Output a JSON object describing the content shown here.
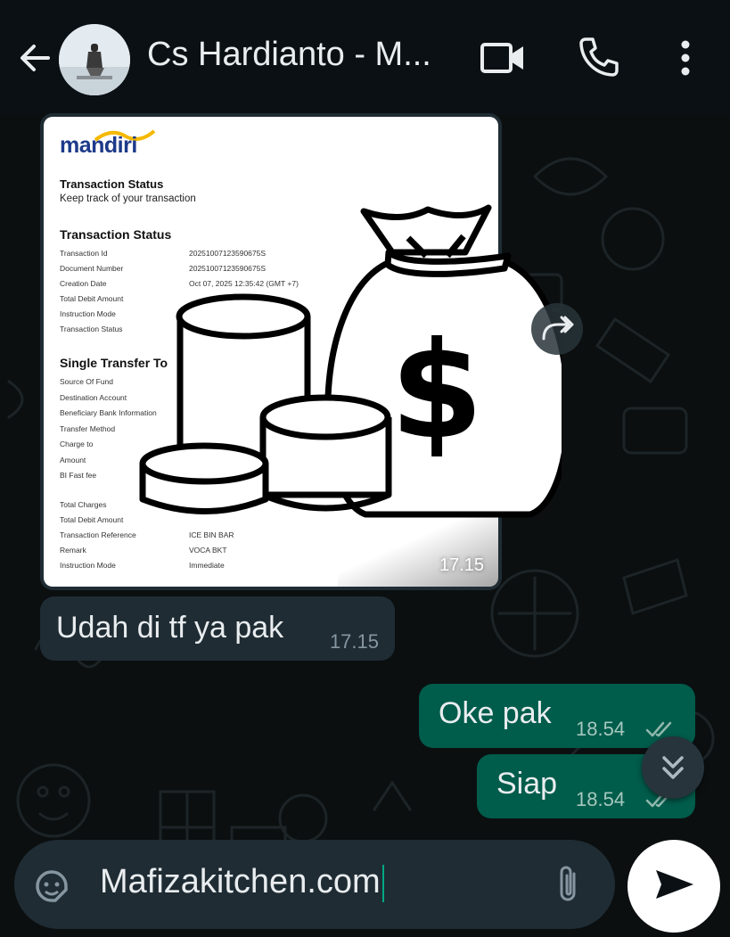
{
  "header": {
    "contact_name": "Cs Hardianto - M..."
  },
  "image_message": {
    "time": "17.15",
    "receipt": {
      "brand": "mandiri",
      "title": "Transaction Status",
      "subtitle": "Keep track of your transaction",
      "section1": "Transaction Status",
      "rows1": [
        {
          "k": "Transaction Id",
          "v": "20251007123590675S"
        },
        {
          "k": "Document Number",
          "v": "20251007123590675S"
        },
        {
          "k": "Creation Date",
          "v": "Oct 07, 2025 12:35:42 (GMT +7)"
        },
        {
          "k": "Total Debit Amount",
          "v": ""
        },
        {
          "k": "Instruction Mode",
          "v": ""
        },
        {
          "k": "Transaction Status",
          "v": ""
        }
      ],
      "section2": "Single Transfer To",
      "rows2": [
        {
          "k": "Source Of Fund",
          "v": ""
        },
        {
          "k": "Destination Account",
          "v": ""
        },
        {
          "k": "Beneficiary Bank Information",
          "v": ""
        },
        {
          "k": "Transfer Method",
          "v": ""
        },
        {
          "k": "Charge to",
          "v": ""
        },
        {
          "k": "Amount",
          "v": ""
        },
        {
          "k": "BI Fast fee",
          "v": ""
        }
      ],
      "rows3": [
        {
          "k": "Total Charges",
          "v": ""
        },
        {
          "k": "Total Debit Amount",
          "v": ""
        },
        {
          "k": "Transaction Reference",
          "v": "ICE BIN BAR"
        },
        {
          "k": "Remark",
          "v": "VOCA BKT"
        },
        {
          "k": "Instruction Mode",
          "v": "Immediate"
        }
      ]
    }
  },
  "messages": [
    {
      "direction": "in",
      "text": "Udah di tf ya pak",
      "time": "17.15"
    },
    {
      "direction": "out",
      "text": "Oke pak",
      "time": "18.54"
    },
    {
      "direction": "out",
      "text": "Siap",
      "time": "18.54"
    }
  ],
  "composer": {
    "value": "Mafizakitchen.com"
  },
  "colors": {
    "header_bg": "#0b1014",
    "incoming_bubble": "#1f2c34",
    "outgoing_bubble": "#005c4b",
    "accent": "#00a884"
  },
  "icons": [
    "back-arrow-icon",
    "video-call-icon",
    "phone-icon",
    "more-vert-icon",
    "forward-icon",
    "double-check-icon",
    "scroll-down-icon",
    "sticker-icon",
    "attach-icon",
    "send-icon"
  ]
}
